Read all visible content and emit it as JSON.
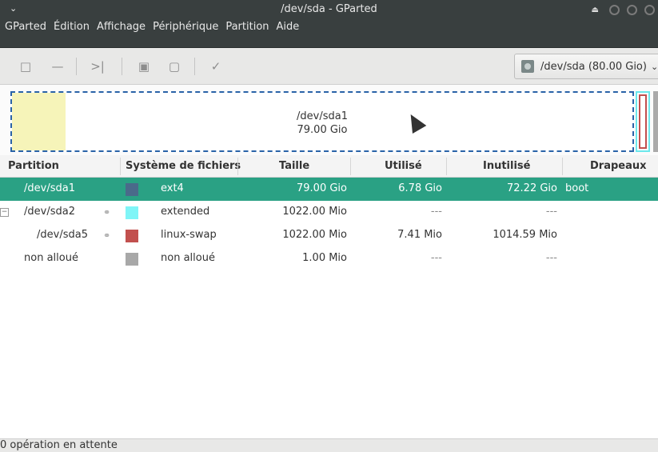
{
  "window": {
    "title": "/dev/sda - GParted"
  },
  "menu": [
    "GParted",
    "Édition",
    "Affichage",
    "Périphérique",
    "Partition",
    "Aide"
  ],
  "toolbar": {
    "device_label": "/dev/sda  (80.00 Gio)"
  },
  "disk_map": {
    "sda1_name": "/dev/sda1",
    "sda1_size": "79.00 Gio",
    "sda1_used_fraction": 0.086
  },
  "table": {
    "headers": [
      "Partition",
      "Système de fichiers",
      "Taille",
      "Utilisé",
      "Inutilisé",
      "Drapeaux"
    ],
    "rows": [
      {
        "partition": "/dev/sda1",
        "fs": "ext4",
        "size": "79.00 Gio",
        "used": "6.78 Gio",
        "unused": "72.22 Gio",
        "flags": "boot",
        "color": "#4a6a8a"
      },
      {
        "partition": "/dev/sda2",
        "fs": "extended",
        "size": "1022.00 Mio",
        "used": "---",
        "unused": "---",
        "flags": "",
        "color": "#7ff5f7"
      },
      {
        "partition": "/dev/sda5",
        "fs": "linux-swap",
        "size": "1022.00 Mio",
        "used": "7.41 Mio",
        "unused": "1014.59 Mio",
        "flags": "",
        "color": "#c2504e"
      },
      {
        "partition": "non alloué",
        "fs": "non alloué",
        "size": "1.00 Mio",
        "used": "---",
        "unused": "---",
        "flags": "",
        "color": "#a8a8a8"
      }
    ]
  },
  "status": {
    "text": "0 opération en attente"
  },
  "colors": {
    "selection": "#2aa184",
    "titlebar": "#393f3f"
  }
}
